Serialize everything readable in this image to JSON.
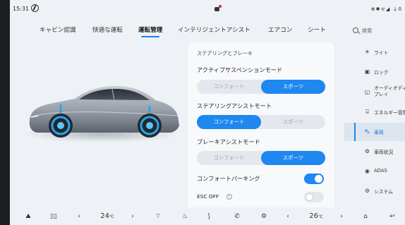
{
  "status": {
    "time": "15:31",
    "right": "⊕✱ᯤ◢ ⏚0"
  },
  "tabs": [
    "キャビン認識",
    "快適な運転",
    "運転管理",
    "インテリジェントアシスト",
    "エアコン",
    "シート"
  ],
  "active_tab": "運転管理",
  "panel": {
    "section_title": "ステアリングとブレーキ",
    "suspension": {
      "label": "アクティブサスペンションモード",
      "options": [
        "コンフォート",
        "スポーツ"
      ],
      "selected": "スポーツ"
    },
    "steering": {
      "label": "ステアリングアシストモート",
      "options": [
        "コンフォート",
        "スポーツ"
      ],
      "selected": "コンフォート"
    },
    "brake": {
      "label": "ブレーキアシストモード",
      "options": [
        "コンフォート",
        "スポーツ"
      ],
      "selected": "スポーツ"
    },
    "comfort_parking": {
      "label": "コンフォートパーキング",
      "on": true
    },
    "esc_off": {
      "label": "ESC OFF",
      "on": false
    }
  },
  "sidebar": {
    "search_placeholder": "検索",
    "items": [
      {
        "label": "ライト",
        "icon": "sun-icon"
      },
      {
        "label": "ロック",
        "icon": "lock-icon"
      },
      {
        "label": "オーディオディス\nプレイ",
        "icon": "display-icon"
      },
      {
        "label": "エネルギー管理",
        "icon": "energy-icon"
      },
      {
        "label": "車両",
        "icon": "car-icon",
        "active": true
      },
      {
        "label": "車両状況",
        "icon": "vehicle-status-icon"
      },
      {
        "label": "ADAS",
        "icon": "adas-icon"
      },
      {
        "label": "システム",
        "icon": "system-icon"
      }
    ]
  },
  "bottom": {
    "left_temp": "24",
    "right_temp": "26",
    "temp_unit": "℃"
  },
  "colors": {
    "accent": "#1e87f0",
    "background": "#eef1f5"
  }
}
